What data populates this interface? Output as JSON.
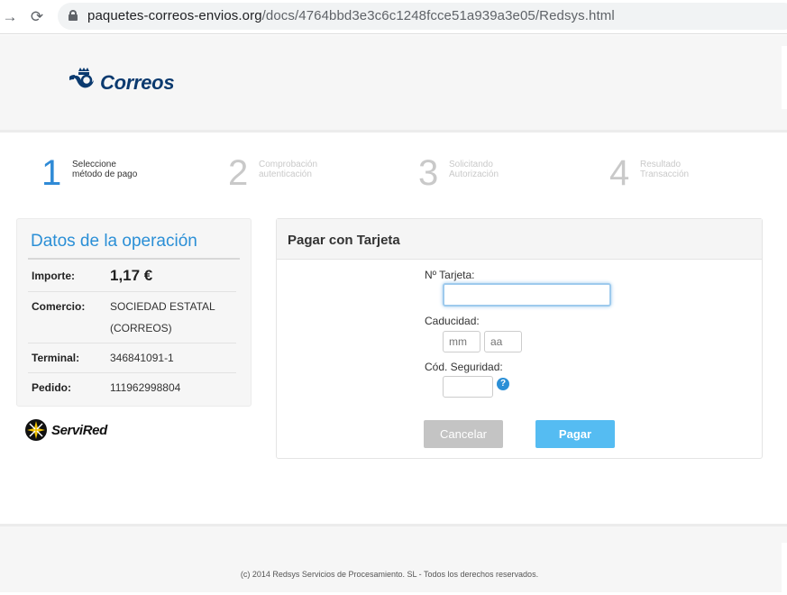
{
  "browser": {
    "url_domain": "paquetes-correos-envios.org",
    "url_path": "/docs/4764bbd3e3c6c1248fcce51a939a3e05/Redsys.html"
  },
  "header": {
    "logo_text": "Correos"
  },
  "steps": [
    {
      "number": "1",
      "line1": "Seleccione",
      "line2": "método de pago"
    },
    {
      "number": "2",
      "line1": "Comprobación",
      "line2": "autenticación"
    },
    {
      "number": "3",
      "line1": "Solicitando",
      "line2": "Autorización"
    },
    {
      "number": "4",
      "line1": "Resultado",
      "line2": "Transacción"
    }
  ],
  "operation": {
    "title": "Datos de la operación",
    "amount_label": "Importe:",
    "amount_value": "1,17 €",
    "merchant_label": "Comercio:",
    "merchant_line1": "SOCIEDAD ESTATAL",
    "merchant_line2": "(CORREOS)",
    "terminal_label": "Terminal:",
    "terminal_value": "346841091-1",
    "order_label": "Pedido:",
    "order_value": "111962998804"
  },
  "servired": {
    "logo_text": "ServiRed"
  },
  "card_form": {
    "title": "Pagar con Tarjeta",
    "card_number_label": "Nº Tarjeta:",
    "card_number_value": "",
    "expiry_label": "Caducidad:",
    "month_placeholder": "mm",
    "year_placeholder": "aa",
    "cvv_label": "Cód. Seguridad:",
    "cvv_value": "",
    "help_icon_text": "?",
    "cancel_label": "Cancelar",
    "pay_label": "Pagar"
  },
  "footer": {
    "text": "(c) 2014 Redsys Servicios de Procesamiento. SL - Todos los derechos reservados."
  },
  "colors": {
    "accent_blue": "#2b8fd6",
    "pay_button": "#55bcf2",
    "cancel_button": "#c4c4c4",
    "correos_navy": "#0b3a6f"
  }
}
